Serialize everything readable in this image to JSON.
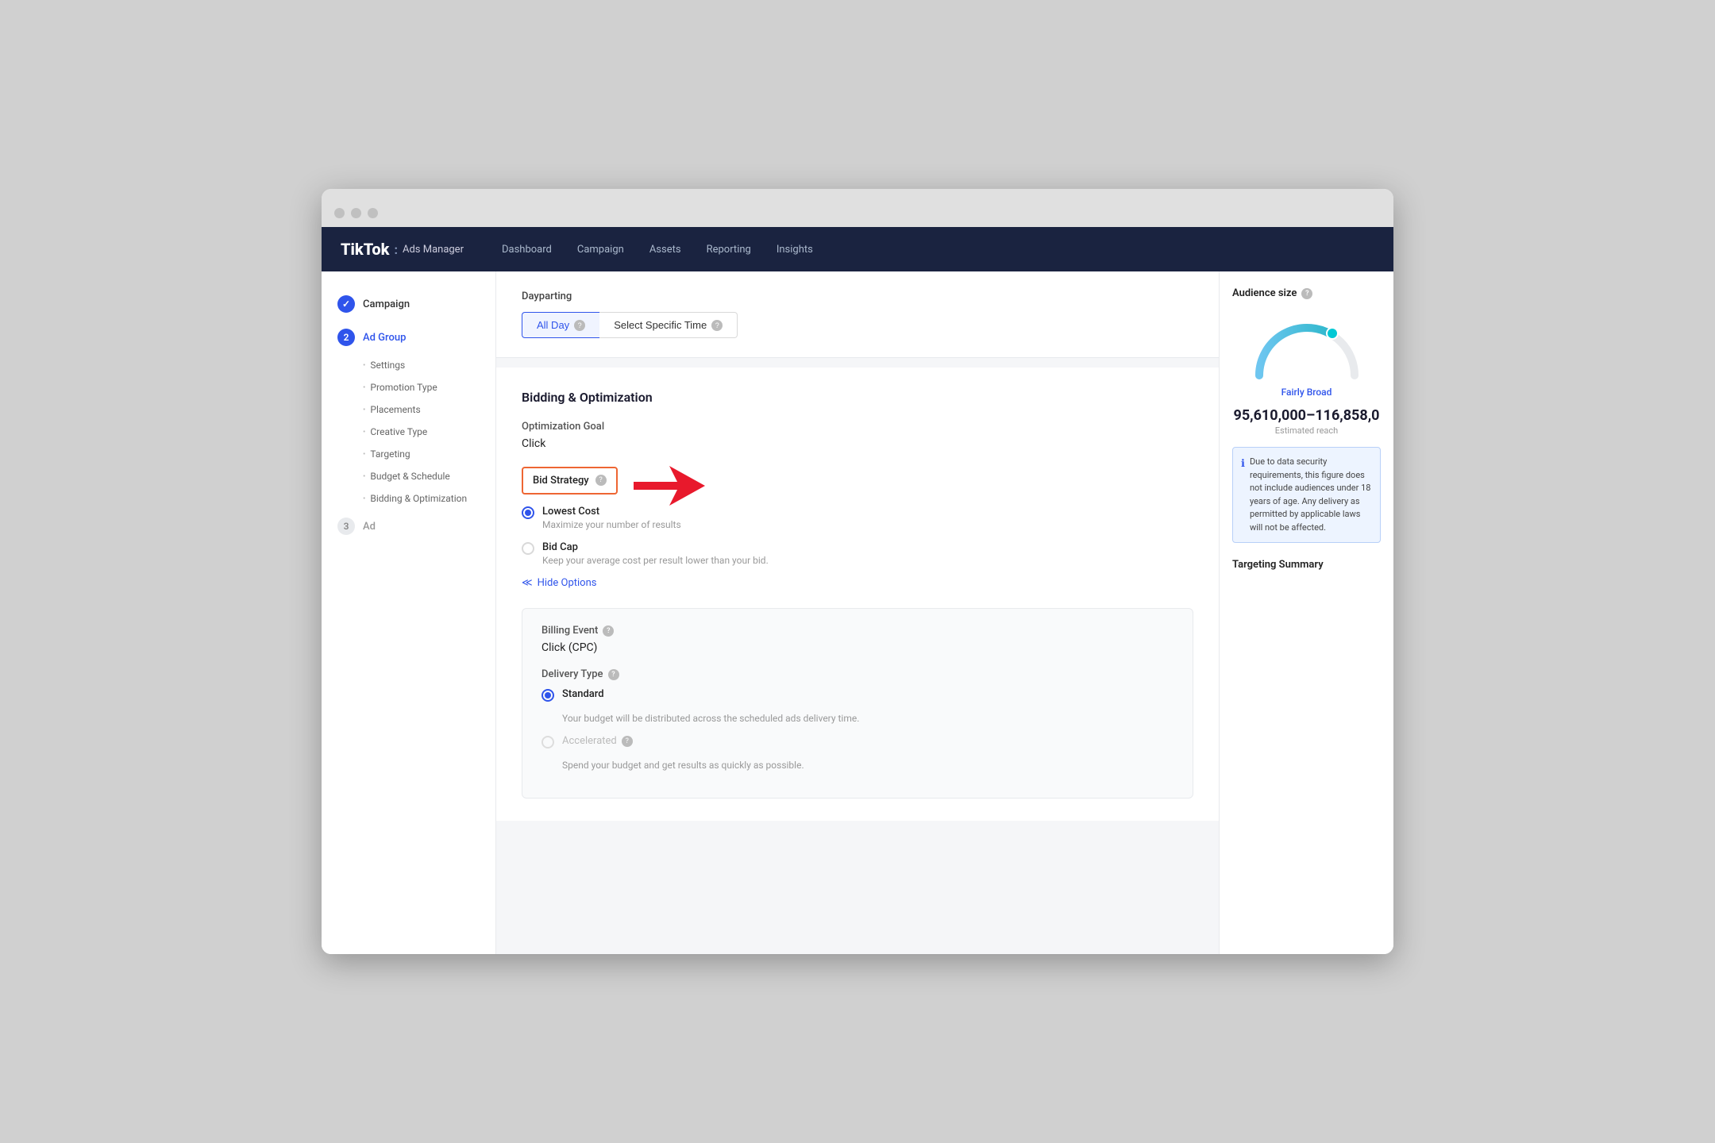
{
  "browser": {
    "traffic_lights": [
      "",
      "",
      ""
    ]
  },
  "topnav": {
    "brand_tiktok": "TikTok",
    "brand_divider": ":",
    "brand_sub": "Ads Manager",
    "nav_items": [
      "Dashboard",
      "Campaign",
      "Assets",
      "Reporting",
      "Insights"
    ]
  },
  "sidebar": {
    "steps": [
      {
        "id": "campaign",
        "number": "✓",
        "label": "Campaign",
        "state": "done"
      },
      {
        "id": "ad-group",
        "number": "2",
        "label": "Ad Group",
        "state": "active"
      },
      {
        "id": "ad",
        "number": "3",
        "label": "Ad",
        "state": "pending"
      }
    ],
    "sub_items": [
      "Settings",
      "Promotion Type",
      "Placements",
      "Creative Type",
      "Targeting",
      "Budget & Schedule",
      "Bidding & Optimization"
    ]
  },
  "dayparting": {
    "label": "Dayparting",
    "all_day": "All Day",
    "select_specific": "Select Specific Time"
  },
  "bidding": {
    "section_title": "Bidding & Optimization",
    "opt_goal_label": "Optimization Goal",
    "opt_goal_value": "Click",
    "bid_strategy_label": "Bid Strategy",
    "strategies": [
      {
        "id": "lowest-cost",
        "label": "Lowest Cost",
        "description": "Maximize your number of results",
        "selected": true
      },
      {
        "id": "bid-cap",
        "label": "Bid Cap",
        "description": "Keep your average cost per result lower than your bid.",
        "selected": false
      }
    ],
    "hide_options_label": "Hide Options",
    "billing_event_label": "Billing Event",
    "billing_event_value": "Click (CPC)",
    "delivery_type_label": "Delivery Type",
    "delivery_options": [
      {
        "id": "standard",
        "label": "Standard",
        "description": "Your budget will be distributed across the scheduled ads delivery time.",
        "selected": true
      },
      {
        "id": "accelerated",
        "label": "Accelerated",
        "description": "Spend your budget and get results as quickly as possible.",
        "selected": false,
        "disabled": true
      }
    ]
  },
  "right_panel": {
    "audience_size_title": "Audience size",
    "gauge_label": "Fairly Broad",
    "reach_number": "95,610,000–116,858,0",
    "reach_sub": "Estimated reach",
    "info_text": "Due to data security requirements, this figure does not include audiences under 18 years of age. Any delivery as permitted by applicable laws will not be affected.",
    "targeting_summary_title": "Targeting Summary"
  }
}
